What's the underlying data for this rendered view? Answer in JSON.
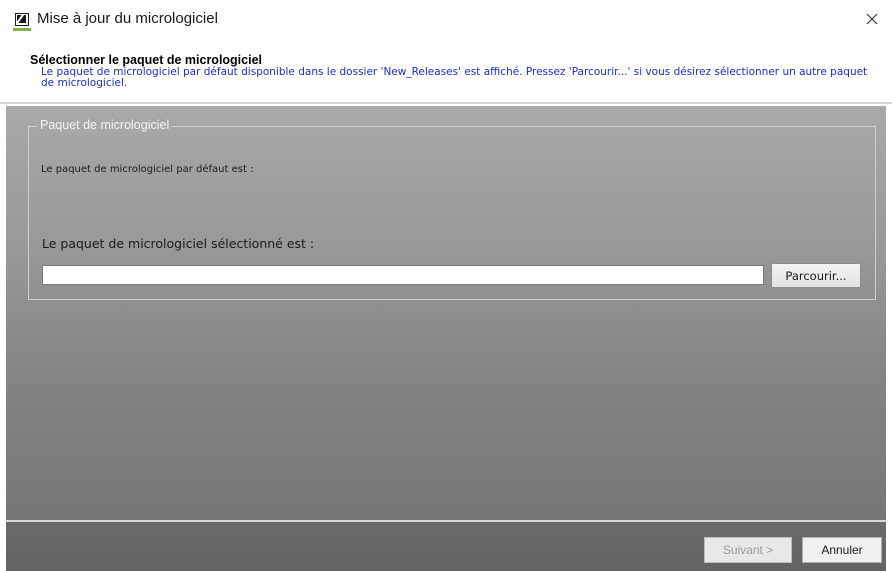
{
  "window": {
    "title": "Mise à jour du micrologiciel",
    "icon": "app-logo-icon",
    "close_icon": "close-icon"
  },
  "header": {
    "title": "Sélectionner le paquet de micrologiciel",
    "description": "Le paquet de micrologiciel par défaut disponible dans le dossier 'New_Releases' est affiché. Pressez 'Parcourir...' si vous désirez sélectionner un autre paquet de micrologiciel.",
    "description_color": "#1a2fcc"
  },
  "group": {
    "legend": "Paquet de micrologiciel",
    "default_label": "Le paquet de micrologiciel par défaut est :",
    "selected_label": "Le paquet de micrologiciel sélectionné est :",
    "path_value": "",
    "browse_label": "Parcourir..."
  },
  "footer": {
    "next_label": "Suivant >",
    "cancel_label": "Annuler"
  }
}
